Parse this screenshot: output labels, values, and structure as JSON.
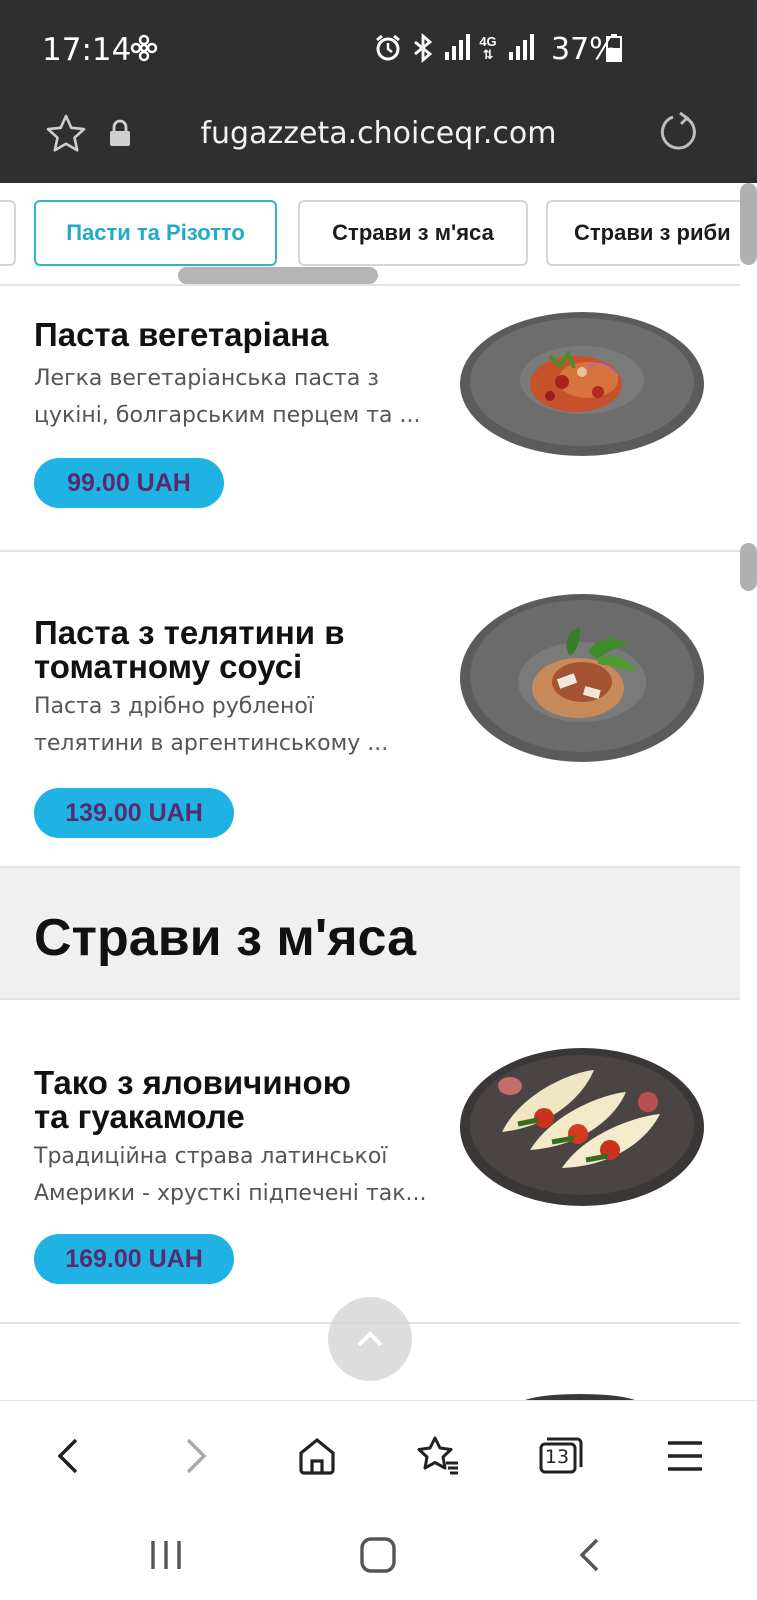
{
  "status_bar": {
    "time": "17:14",
    "network": "4G",
    "battery": "37%"
  },
  "url_bar": {
    "url": "fugazzeta.choiceqr.com"
  },
  "tabs": [
    {
      "label": "Пасти та Різотто",
      "active": true
    },
    {
      "label": "Страви з м'яса",
      "active": false
    },
    {
      "label": "Страви з риби",
      "active": false
    }
  ],
  "items": [
    {
      "title": "Паста вегетаріана",
      "description_line1": "Легка вегетаріанська паста з",
      "description_line2": "цукіні, болгарським перцем та ...",
      "price": "99.00 UAH"
    },
    {
      "title_line1": "Паста з телятини в",
      "title_line2": "томатному соусі",
      "description_line1": "Паста з дрібно рубленої",
      "description_line2": "телятини в аргентинському ...",
      "price": "139.00 UAH"
    },
    {
      "title_line1": "Тако з яловичиною",
      "title_line2": "та гуакамоле",
      "description_line1": "Традиційна страва латинської",
      "description_line2": "Америки  - хрусткі підпечені так...",
      "price": "169.00 UAH"
    }
  ],
  "section": {
    "title": "Страви з м'яса"
  },
  "bottom_nav": {
    "tabs_count": "13"
  },
  "colors": {
    "accent": "#1fb3e3",
    "active_tab": "#23a9c4",
    "price_text": "#5a2a6e",
    "chrome": "#2f2f2f"
  }
}
